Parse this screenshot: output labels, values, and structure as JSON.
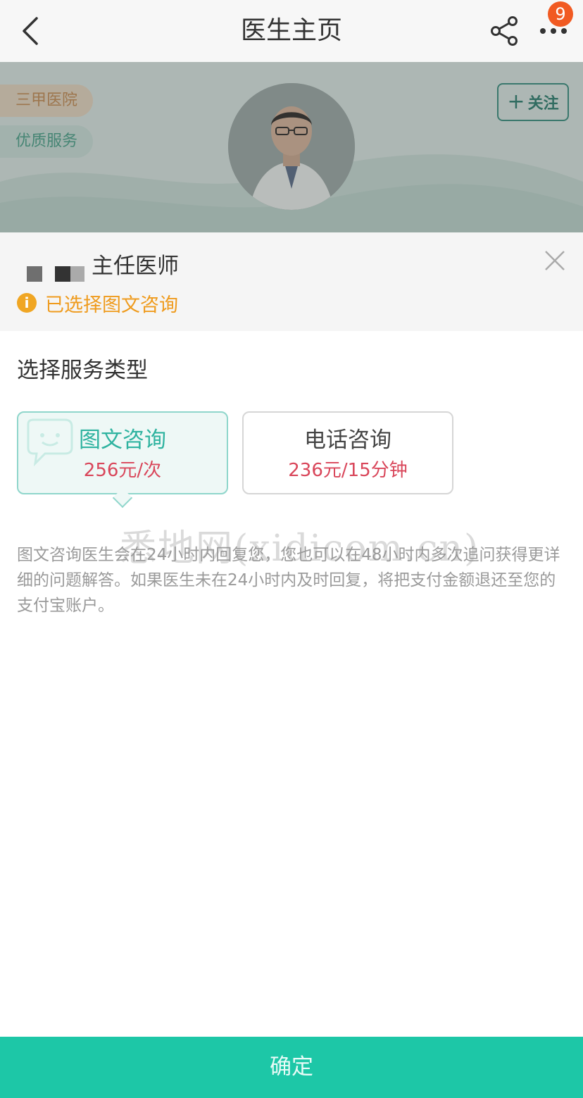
{
  "nav": {
    "title": "医生主页",
    "badge_count": "9",
    "icons": [
      "back-icon",
      "share-icon",
      "more-icon"
    ]
  },
  "profile": {
    "tags": [
      "三甲医院",
      "优质服务"
    ],
    "follow_label": "关注"
  },
  "sheet": {
    "doctor_title": "主任医师",
    "selected_text": "已选择图文咨询",
    "info_icon_glyph": "i"
  },
  "service": {
    "section_title": "选择服务类型",
    "options": [
      {
        "name": "图文咨询",
        "price": "256元/次",
        "selected": true
      },
      {
        "name": "电话咨询",
        "price": "236元/15分钟",
        "selected": false
      }
    ],
    "description": "图文咨询医生会在24小时内回复您，您也可以在48小时内多次追问获得更详细的问题解答。如果医生未在24小时内及时回复，将把支付金额退还至您的支付宝账户。"
  },
  "watermark": "悉地网(xidicom.cn)",
  "confirm_label": "确定",
  "colors": {
    "accent": "#1dc7a7",
    "price": "#d9465a",
    "warning": "#ef9b1d",
    "badge": "#f15a22"
  }
}
